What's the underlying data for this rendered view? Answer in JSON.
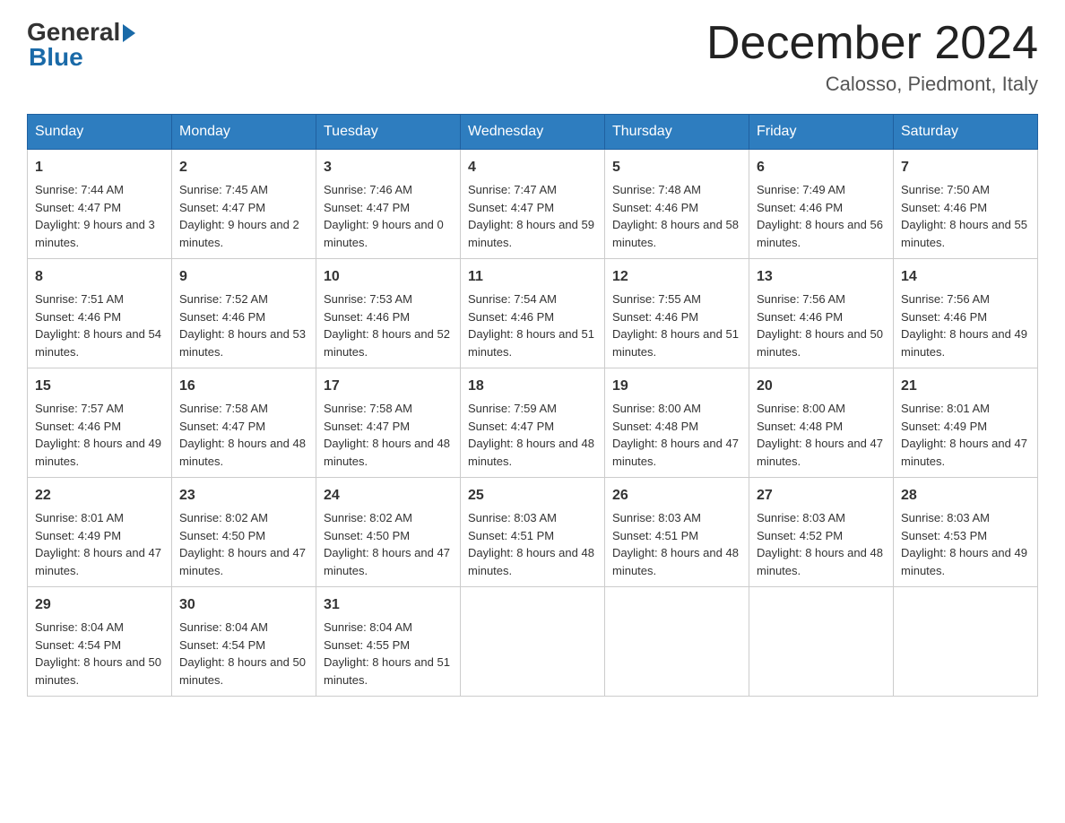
{
  "header": {
    "logo_general": "General",
    "logo_blue": "Blue",
    "month_title": "December 2024",
    "location": "Calosso, Piedmont, Italy"
  },
  "days_of_week": [
    "Sunday",
    "Monday",
    "Tuesday",
    "Wednesday",
    "Thursday",
    "Friday",
    "Saturday"
  ],
  "weeks": [
    [
      {
        "day": "1",
        "sunrise": "7:44 AM",
        "sunset": "4:47 PM",
        "daylight": "9 hours and 3 minutes."
      },
      {
        "day": "2",
        "sunrise": "7:45 AM",
        "sunset": "4:47 PM",
        "daylight": "9 hours and 2 minutes."
      },
      {
        "day": "3",
        "sunrise": "7:46 AM",
        "sunset": "4:47 PM",
        "daylight": "9 hours and 0 minutes."
      },
      {
        "day": "4",
        "sunrise": "7:47 AM",
        "sunset": "4:47 PM",
        "daylight": "8 hours and 59 minutes."
      },
      {
        "day": "5",
        "sunrise": "7:48 AM",
        "sunset": "4:46 PM",
        "daylight": "8 hours and 58 minutes."
      },
      {
        "day": "6",
        "sunrise": "7:49 AM",
        "sunset": "4:46 PM",
        "daylight": "8 hours and 56 minutes."
      },
      {
        "day": "7",
        "sunrise": "7:50 AM",
        "sunset": "4:46 PM",
        "daylight": "8 hours and 55 minutes."
      }
    ],
    [
      {
        "day": "8",
        "sunrise": "7:51 AM",
        "sunset": "4:46 PM",
        "daylight": "8 hours and 54 minutes."
      },
      {
        "day": "9",
        "sunrise": "7:52 AM",
        "sunset": "4:46 PM",
        "daylight": "8 hours and 53 minutes."
      },
      {
        "day": "10",
        "sunrise": "7:53 AM",
        "sunset": "4:46 PM",
        "daylight": "8 hours and 52 minutes."
      },
      {
        "day": "11",
        "sunrise": "7:54 AM",
        "sunset": "4:46 PM",
        "daylight": "8 hours and 51 minutes."
      },
      {
        "day": "12",
        "sunrise": "7:55 AM",
        "sunset": "4:46 PM",
        "daylight": "8 hours and 51 minutes."
      },
      {
        "day": "13",
        "sunrise": "7:56 AM",
        "sunset": "4:46 PM",
        "daylight": "8 hours and 50 minutes."
      },
      {
        "day": "14",
        "sunrise": "7:56 AM",
        "sunset": "4:46 PM",
        "daylight": "8 hours and 49 minutes."
      }
    ],
    [
      {
        "day": "15",
        "sunrise": "7:57 AM",
        "sunset": "4:46 PM",
        "daylight": "8 hours and 49 minutes."
      },
      {
        "day": "16",
        "sunrise": "7:58 AM",
        "sunset": "4:47 PM",
        "daylight": "8 hours and 48 minutes."
      },
      {
        "day": "17",
        "sunrise": "7:58 AM",
        "sunset": "4:47 PM",
        "daylight": "8 hours and 48 minutes."
      },
      {
        "day": "18",
        "sunrise": "7:59 AM",
        "sunset": "4:47 PM",
        "daylight": "8 hours and 48 minutes."
      },
      {
        "day": "19",
        "sunrise": "8:00 AM",
        "sunset": "4:48 PM",
        "daylight": "8 hours and 47 minutes."
      },
      {
        "day": "20",
        "sunrise": "8:00 AM",
        "sunset": "4:48 PM",
        "daylight": "8 hours and 47 minutes."
      },
      {
        "day": "21",
        "sunrise": "8:01 AM",
        "sunset": "4:49 PM",
        "daylight": "8 hours and 47 minutes."
      }
    ],
    [
      {
        "day": "22",
        "sunrise": "8:01 AM",
        "sunset": "4:49 PM",
        "daylight": "8 hours and 47 minutes."
      },
      {
        "day": "23",
        "sunrise": "8:02 AM",
        "sunset": "4:50 PM",
        "daylight": "8 hours and 47 minutes."
      },
      {
        "day": "24",
        "sunrise": "8:02 AM",
        "sunset": "4:50 PM",
        "daylight": "8 hours and 47 minutes."
      },
      {
        "day": "25",
        "sunrise": "8:03 AM",
        "sunset": "4:51 PM",
        "daylight": "8 hours and 48 minutes."
      },
      {
        "day": "26",
        "sunrise": "8:03 AM",
        "sunset": "4:51 PM",
        "daylight": "8 hours and 48 minutes."
      },
      {
        "day": "27",
        "sunrise": "8:03 AM",
        "sunset": "4:52 PM",
        "daylight": "8 hours and 48 minutes."
      },
      {
        "day": "28",
        "sunrise": "8:03 AM",
        "sunset": "4:53 PM",
        "daylight": "8 hours and 49 minutes."
      }
    ],
    [
      {
        "day": "29",
        "sunrise": "8:04 AM",
        "sunset": "4:54 PM",
        "daylight": "8 hours and 50 minutes."
      },
      {
        "day": "30",
        "sunrise": "8:04 AM",
        "sunset": "4:54 PM",
        "daylight": "8 hours and 50 minutes."
      },
      {
        "day": "31",
        "sunrise": "8:04 AM",
        "sunset": "4:55 PM",
        "daylight": "8 hours and 51 minutes."
      },
      null,
      null,
      null,
      null
    ]
  ],
  "labels": {
    "sunrise": "Sunrise:",
    "sunset": "Sunset:",
    "daylight": "Daylight:"
  }
}
